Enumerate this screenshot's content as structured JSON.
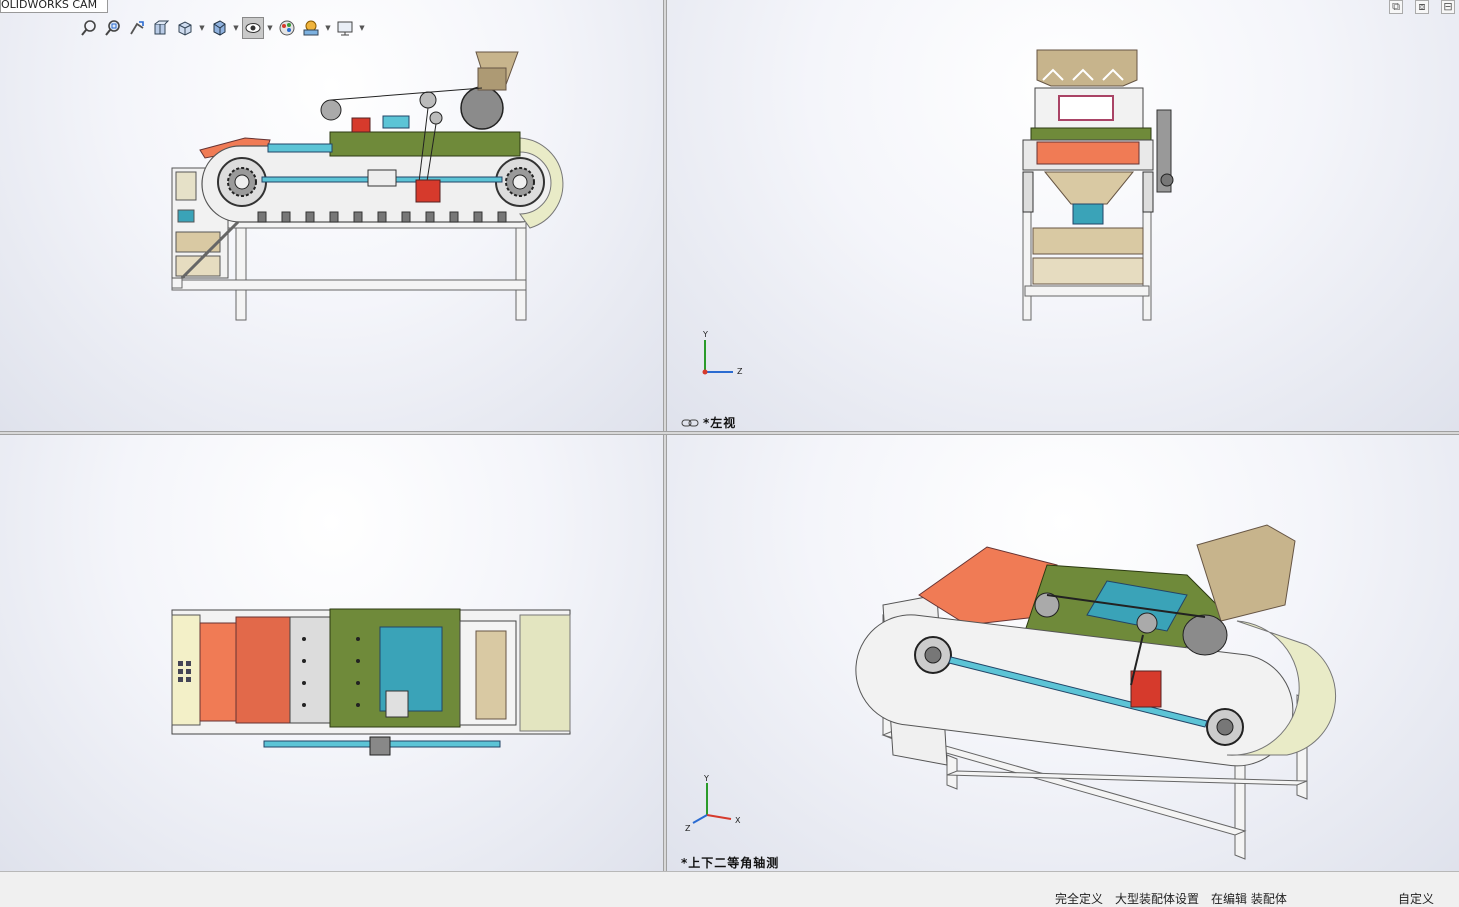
{
  "app": {
    "tab_label": "OLIDWORKS CAM"
  },
  "toolbar": {
    "icons": [
      "zoom-to-fit-icon",
      "zoom-area-icon",
      "previous-view-icon",
      "section-view-icon",
      "view-orientation-icon",
      "display-style-icon",
      "hide-show-items-icon",
      "edit-appearance-icon",
      "apply-scene-icon",
      "view-settings-icon"
    ]
  },
  "viewports": {
    "top_left": {
      "label": ""
    },
    "top_right": {
      "label": "*左视",
      "triad": {
        "y": "Y",
        "z": "Z"
      }
    },
    "bottom_left": {
      "label": ""
    },
    "bottom_right": {
      "label": "*上下二等角轴测",
      "triad": {
        "y": "Y",
        "x": "X",
        "z": "Z"
      }
    }
  },
  "statusbar": {
    "items": [
      "完全定义",
      "大型装配体设置",
      "在编辑 装配体"
    ],
    "custom": "自定义"
  },
  "colors": {
    "frame": "#f2f2f2",
    "belt_housing": "#e9ebc7",
    "plate_green": "#6f8a3a",
    "hopper": "#c7b48c",
    "chute_orange": "#f07b55",
    "shaft_blue": "#5cc4d6",
    "panel_tan": "#d9c9a3",
    "motor_grey": "#8b8b8b",
    "accent_red": "#d63a2c"
  }
}
